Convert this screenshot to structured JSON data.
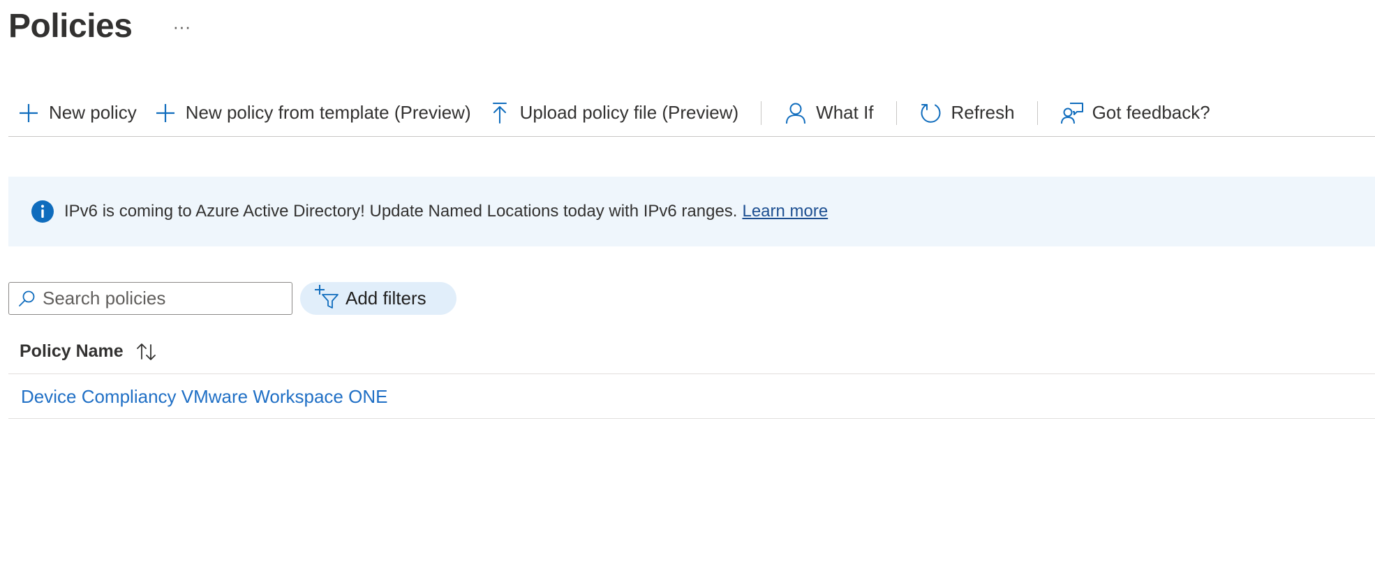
{
  "page": {
    "title": "Policies",
    "more_label": "···"
  },
  "toolbar": {
    "items": [
      {
        "label": "New policy",
        "icon": "plus-icon"
      },
      {
        "label": "New policy from template (Preview)",
        "icon": "plus-icon"
      },
      {
        "label": "Upload policy file (Preview)",
        "icon": "upload-icon"
      },
      {
        "label": "What If",
        "icon": "person-icon"
      },
      {
        "label": "Refresh",
        "icon": "refresh-icon"
      },
      {
        "label": "Got feedback?",
        "icon": "feedback-icon"
      }
    ]
  },
  "banner": {
    "text": "IPv6 is coming to Azure Active Directory! Update Named Locations today with IPv6 ranges.",
    "link": "Learn more",
    "icon": "info-icon"
  },
  "search": {
    "placeholder": "Search policies",
    "value": ""
  },
  "filters": {
    "label": "Add filters",
    "icon": "add-filter-icon"
  },
  "table": {
    "columns": [
      {
        "label": "Policy Name",
        "sort_icon": "sort-arrows-icon"
      }
    ],
    "rows": [
      {
        "name": "Device Compliancy VMware Workspace ONE"
      }
    ]
  },
  "colors": {
    "accent": "#0f6cbd",
    "link": "#1f6fc5",
    "banner_bg": "#eff6fc",
    "filter_bg": "#e1eefa",
    "text": "#323130"
  }
}
